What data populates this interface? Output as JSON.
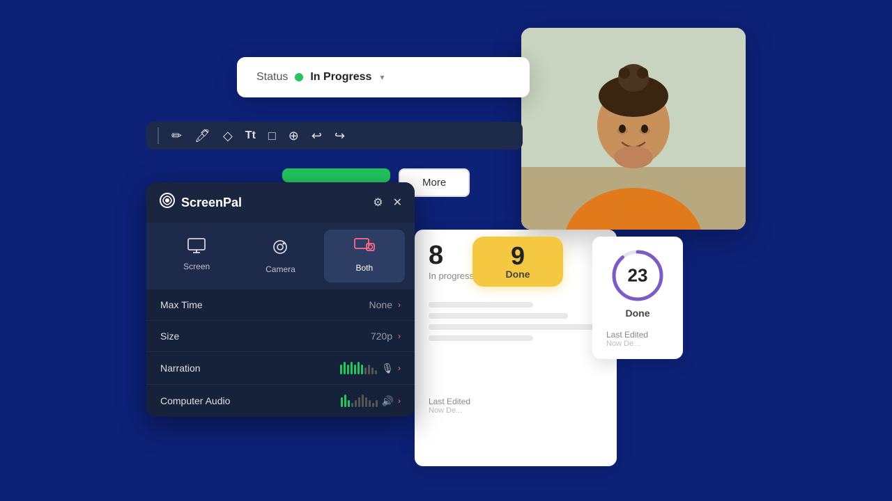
{
  "background_color": "#0d2177",
  "status_card": {
    "label": "Status",
    "dot_color": "#22c55e",
    "value": "In Progress",
    "chevron": "▾"
  },
  "toolbar": {
    "items": [
      {
        "name": "pen-icon",
        "symbol": "✏️"
      },
      {
        "name": "highlight-icon",
        "symbol": "🖍"
      },
      {
        "name": "eraser-icon",
        "symbol": "◇"
      },
      {
        "name": "text-icon",
        "symbol": "Tt"
      },
      {
        "name": "shape-icon",
        "symbol": "□"
      },
      {
        "name": "zoom-icon",
        "symbol": "🔍"
      },
      {
        "name": "undo-icon",
        "symbol": "↩"
      },
      {
        "name": "redo-icon",
        "symbol": "↪"
      }
    ]
  },
  "green_button": {
    "label": ""
  },
  "more_button": {
    "label": "More"
  },
  "task_card": {
    "number": "8",
    "status": "In progress",
    "last_edited_label": "Last Edited",
    "last_edited_value": "Now De..."
  },
  "done_badge": {
    "number": "9",
    "label": "Done"
  },
  "done_circle": {
    "number": "23",
    "label": "Done",
    "last_edited_label": "Last Edited",
    "last_edited_value": "Now De..."
  },
  "screenpal": {
    "logo_text": "ScreenPal",
    "modes": [
      {
        "id": "screen",
        "label": "Screen",
        "active": false
      },
      {
        "id": "camera",
        "label": "Camera",
        "active": false
      },
      {
        "id": "both",
        "label": "Both",
        "active": true
      }
    ],
    "settings": [
      {
        "label": "Max Time",
        "value": "None"
      },
      {
        "label": "Size",
        "value": "720p"
      },
      {
        "label": "Narration",
        "value": ""
      },
      {
        "label": "Computer Audio",
        "value": ""
      }
    ]
  },
  "narration_bars": [
    {
      "height": 14,
      "color": "#22c55e"
    },
    {
      "height": 18,
      "color": "#22c55e"
    },
    {
      "height": 14,
      "color": "#22c55e"
    },
    {
      "height": 18,
      "color": "#22c55e"
    },
    {
      "height": 14,
      "color": "#22c55e"
    },
    {
      "height": 18,
      "color": "#22c55e"
    },
    {
      "height": 14,
      "color": "#22c55e"
    },
    {
      "height": 10,
      "color": "#555"
    },
    {
      "height": 14,
      "color": "#555"
    },
    {
      "height": 10,
      "color": "#555"
    },
    {
      "height": 6,
      "color": "#555"
    }
  ],
  "computer_audio_bars": [
    {
      "height": 14,
      "color": "#22c55e"
    },
    {
      "height": 18,
      "color": "#22c55e"
    },
    {
      "height": 10,
      "color": "#22c55e"
    },
    {
      "height": 6,
      "color": "#555"
    },
    {
      "height": 10,
      "color": "#555"
    },
    {
      "height": 14,
      "color": "#555"
    },
    {
      "height": 18,
      "color": "#555"
    },
    {
      "height": 14,
      "color": "#555"
    },
    {
      "height": 10,
      "color": "#555"
    },
    {
      "height": 6,
      "color": "#555"
    },
    {
      "height": 10,
      "color": "#555"
    }
  ]
}
